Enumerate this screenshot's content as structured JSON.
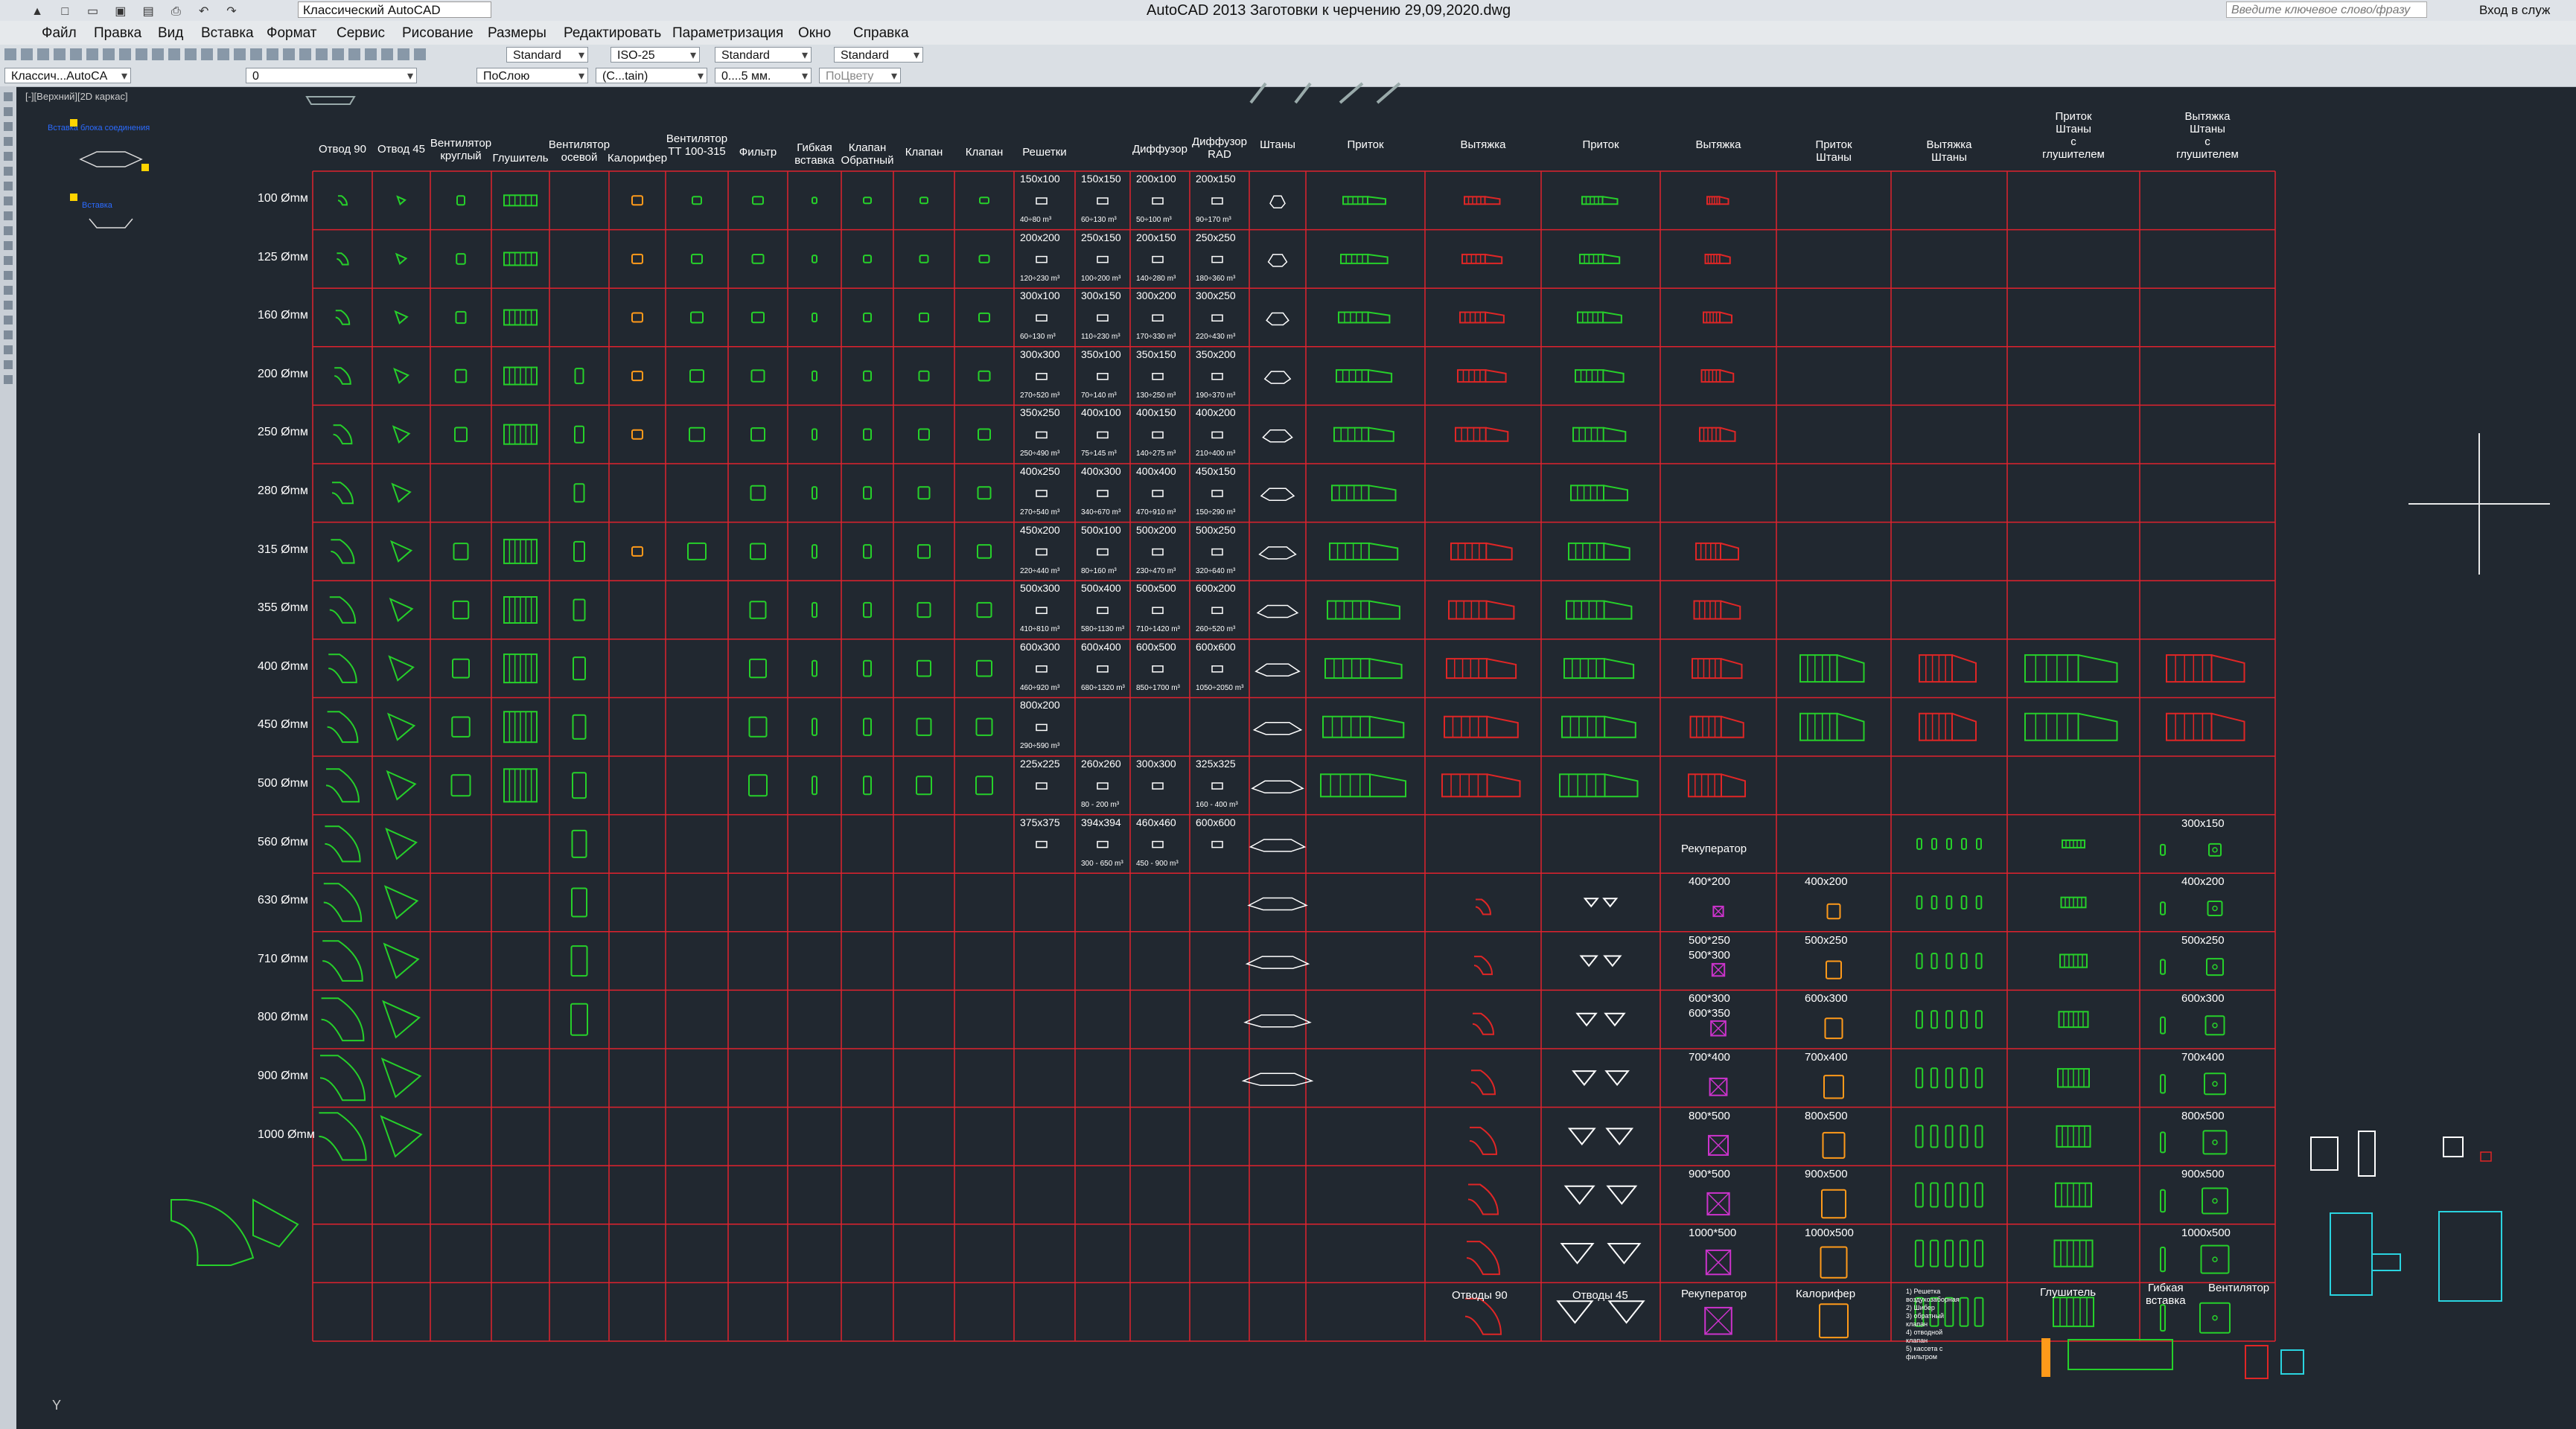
{
  "app": {
    "workspace": "Классический AutoCAD",
    "title": "AutoCAD 2013    Заготовки к черчению 29,09,2020.dwg",
    "search_placeholder": "Введите ключевое слово/фразу",
    "signin": "Вход в служ"
  },
  "menu": [
    "Файл",
    "Правка",
    "Вид",
    "Вставка",
    "Формат",
    "Сервис",
    "Рисование",
    "Размеры",
    "Редактировать",
    "Параметризация",
    "Окно",
    "Справка"
  ],
  "toolbar": {
    "text_style": "Standard",
    "dim_style": "ISO-25",
    "table_style": "Standard",
    "mleader_style": "Standard",
    "workspace2": "Классич...AutoCA",
    "layer": "0",
    "color": "ПоСлою",
    "linetype": "(С...tain)",
    "lineweight": "0....5 мм.",
    "plotstyle": "ПоЦвету"
  },
  "viewport_label": "[-][Верхний][2D каркас]",
  "ucs_label": "Y",
  "blue_notes": [
    "Вставка блока соединения",
    "Вставка"
  ],
  "headers": [
    "Отвод 90",
    "Отвод 45",
    "Вентилятор\nкруглый",
    "Глушитель",
    "Вентилятор\nосевой",
    "Калорифер",
    "Вентилятор\nТТ 100-315",
    "Фильтр",
    "Гибкая\nвставка",
    "Клапан\nОбратный",
    "Клапан",
    "Клапан",
    "Решетки",
    "",
    "Диффузор",
    "Диффузор\nRAD",
    "Штаны",
    "Приток",
    "Вытяжка",
    "Приток",
    "Вытяжка",
    "Приток\nШтаны",
    "Вытяжка\nШтаны",
    "Приток\nШтаны\nс\nглушителем",
    "Вытяжка\nШтаны\nс\nглушителем"
  ],
  "rows": [
    "100 Ømм",
    "125 Ømм",
    "160 Ømм",
    "200 Ømм",
    "250 Ømм",
    "280 Ømм",
    "315 Ømм",
    "355 Ømм",
    "400 Ømм",
    "450 Ømм",
    "500 Ømм",
    "560 Ømм",
    "630 Ømм",
    "710 Ømм",
    "800 Ømм",
    "900 Ømм",
    "1000 Ømм"
  ],
  "grilles": [
    [
      "150x100",
      "150x150",
      "200x100",
      "200x150"
    ],
    [
      "200x200",
      "250x150",
      "200x150",
      "250x250"
    ],
    [
      "300x100",
      "300x150",
      "300x200",
      "300x250"
    ],
    [
      "300x300",
      "350x100",
      "350x150",
      "350x200"
    ],
    [
      "350x250",
      "400x100",
      "400x150",
      "400x200"
    ],
    [
      "400x250",
      "400x300",
      "400x400",
      "450x150"
    ],
    [
      "450x200",
      "500x100",
      "500x200",
      "500x250"
    ],
    [
      "500x300",
      "500x400",
      "500x500",
      "600x200"
    ],
    [
      "600x300",
      "600x400",
      "600x500",
      "600x600"
    ],
    [
      "800x200",
      "",
      "",
      ""
    ],
    [
      "225x225",
      "260x260",
      "300x300",
      "325x325"
    ],
    [
      "375x375",
      "394x394",
      "460x460",
      "600x600"
    ]
  ],
  "flows": [
    [
      "40÷80 m³",
      "60÷130 m³",
      "50÷100 m³",
      "90÷170 m³"
    ],
    [
      "120÷230 m³",
      "100÷200 m³",
      "140÷280 m³",
      "180÷360 m³"
    ],
    [
      "60÷130 m³",
      "110÷230 m³",
      "170÷330 m³",
      "220÷430 m³"
    ],
    [
      "270÷520 m³",
      "70÷140 m³",
      "130÷250 m³",
      "190÷370 m³"
    ],
    [
      "250÷490 m³",
      "75÷145 m³",
      "140÷275 m³",
      "210÷400 m³"
    ],
    [
      "270÷540 m³",
      "340÷670 m³",
      "470÷910 m³",
      "150÷290 m³"
    ],
    [
      "220÷440 m³",
      "80÷160 m³",
      "230÷470 m³",
      "320÷640 m³"
    ],
    [
      "410÷810 m³",
      "580÷1130 m³",
      "710÷1420 m³",
      "260÷520 m³"
    ],
    [
      "460÷920 m³",
      "680÷1320 m³",
      "850÷1700 m³",
      "1050÷2050 m³"
    ],
    [
      "290÷590 m³",
      "",
      "",
      ""
    ],
    [
      "",
      "80 - 200 m³",
      "",
      "160 - 400 m³"
    ],
    [
      "",
      "300 - 650 m³",
      "450 - 900 m³",
      ""
    ]
  ],
  "recuperator_label": "Рекуператор",
  "recuperator_sizes": [
    "400*200",
    "500*250\n500*300",
    "600*300\n600*350",
    "700*400",
    "800*500",
    "900*500",
    "1000*500"
  ],
  "heater_sizes": [
    "400x200",
    "500x250",
    "600x300",
    "700x400",
    "800x500",
    "900x500",
    "1000x500"
  ],
  "right_sizes": [
    "300x150",
    "400x200",
    "500x250",
    "600x300",
    "700x400",
    "800x500",
    "900x500",
    "1000x500"
  ],
  "bottom_labels": [
    "Отводы 90",
    "Отводы 45",
    "Рекуператор",
    "Калорифер",
    "Глушитель",
    "Гибкая\nвставка",
    "Вентилятор"
  ],
  "notes_text": "1) Решетка\nвоздухозаборная\n2) Шибер\n3) обратный\nклапан\n4) отводной\nклапан\n5) кассета с\nфильтром",
  "colors": {
    "grid": "#e0222e",
    "supply": "#26d02a",
    "exhaust": "#e02626",
    "heater": "#ff9a1a",
    "recup": "#cc33cc",
    "cyan": "#2ad4e0",
    "bg": "#212830"
  }
}
